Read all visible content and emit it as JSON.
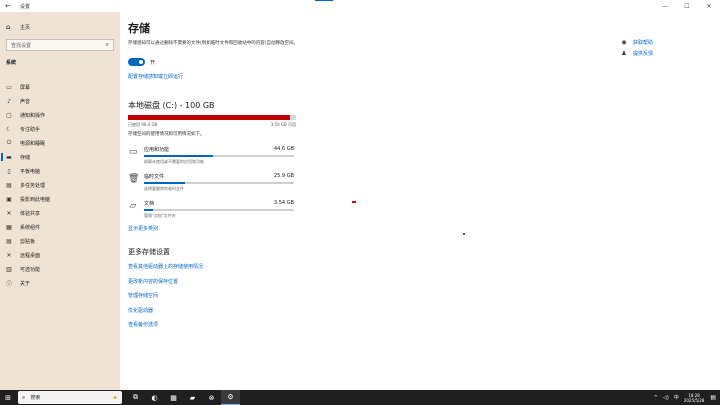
{
  "window": {
    "back_glyph": "←",
    "title": "设置",
    "controls": [
      "—",
      "☐",
      "✕"
    ]
  },
  "sidebar": {
    "home": {
      "icon": "home-icon",
      "glyph": "⌂",
      "label": "主页"
    },
    "search_placeholder": "查找设置",
    "section": "系统",
    "items": [
      {
        "icon": "display-icon",
        "glyph": "▭",
        "label": "屏幕"
      },
      {
        "icon": "sound-icon",
        "glyph": "♪",
        "label": "声音"
      },
      {
        "icon": "notifications-icon",
        "glyph": "▢",
        "label": "通知和操作"
      },
      {
        "icon": "focus-assist-icon",
        "glyph": "☾",
        "label": "专注助手"
      },
      {
        "icon": "power-icon",
        "glyph": "⏻",
        "label": "电源和睡眠"
      },
      {
        "icon": "storage-icon",
        "glyph": "▬",
        "label": "存储",
        "active": true
      },
      {
        "icon": "tablet-icon",
        "glyph": "▯",
        "label": "平板电脑"
      },
      {
        "icon": "multitasking-icon",
        "glyph": "▤",
        "label": "多任务处理"
      },
      {
        "icon": "projecting-icon",
        "glyph": "▣",
        "label": "投影到此电脑"
      },
      {
        "icon": "shared-experiences-icon",
        "glyph": "✕",
        "label": "体验共享"
      },
      {
        "icon": "system-components-icon",
        "glyph": "▦",
        "label": "系统组件"
      },
      {
        "icon": "clipboard-icon",
        "glyph": "▤",
        "label": "剪贴板"
      },
      {
        "icon": "remote-desktop-icon",
        "glyph": "✕",
        "label": "远程桌面"
      },
      {
        "icon": "optional-features-icon",
        "glyph": "▥",
        "label": "可选功能"
      },
      {
        "icon": "about-icon",
        "glyph": "ⓘ",
        "label": "关于"
      }
    ]
  },
  "main": {
    "title": "存储",
    "description": "存储感知可以通过删除不需要的文件(例如临时文件和回收站中的内容)自动释放空间。",
    "toggle_state": "开",
    "configure_link": "配置存储感知或立即运行",
    "disk": {
      "title": "本地磁盘 (C:) - 100 GB",
      "used_label": "已使用 96.4 GB",
      "free_label": "3.50 GB 可用",
      "used_fraction": 0.964,
      "hint": "存储空间的使用情况和可用情况如下。"
    },
    "categories": [
      {
        "icon": "apps-icon",
        "glyph": "▭",
        "name": "应用和功能",
        "size": "44.6 GB",
        "fraction": 0.46,
        "sub": "卸载未使用或不需要的应用和功能"
      },
      {
        "icon": "trash-icon",
        "glyph": "🗑",
        "name": "临时文件",
        "size": "25.9 GB",
        "fraction": 0.27,
        "sub": "选择要删除的临时文件"
      },
      {
        "icon": "folder-icon",
        "glyph": "▱",
        "name": "文档",
        "size": "3.54 GB",
        "fraction": 0.06,
        "sub": "管理\"文档\"文件夹"
      }
    ],
    "show_more": "显示更多类别",
    "more_title": "更多存储设置",
    "more_links": [
      "查看其他驱动器上的存储使用情况",
      "更改新内容的保存位置",
      "管理存储空间",
      "优化驱动器",
      "查看备份选项"
    ]
  },
  "right": [
    {
      "icon": "get-help-icon",
      "glyph": "◉",
      "label": "获取帮助"
    },
    {
      "icon": "feedback-icon",
      "glyph": "♟",
      "label": "提供反馈"
    }
  ],
  "taskbar": {
    "search_placeholder": "搜索",
    "apps": [
      {
        "icon": "task-view-icon",
        "glyph": "⧉"
      },
      {
        "icon": "edge-icon",
        "glyph": "◐"
      },
      {
        "icon": "store-icon",
        "glyph": "▦"
      },
      {
        "icon": "file-explorer-icon",
        "glyph": "▰"
      },
      {
        "icon": "xbox-icon",
        "glyph": "⊗"
      },
      {
        "icon": "settings-icon",
        "glyph": "⚙",
        "active": true
      }
    ],
    "tray": {
      "chevron": "^",
      "volume": "◁)",
      "ime": "中",
      "time": "18:28",
      "date": "2025/5/28"
    }
  }
}
